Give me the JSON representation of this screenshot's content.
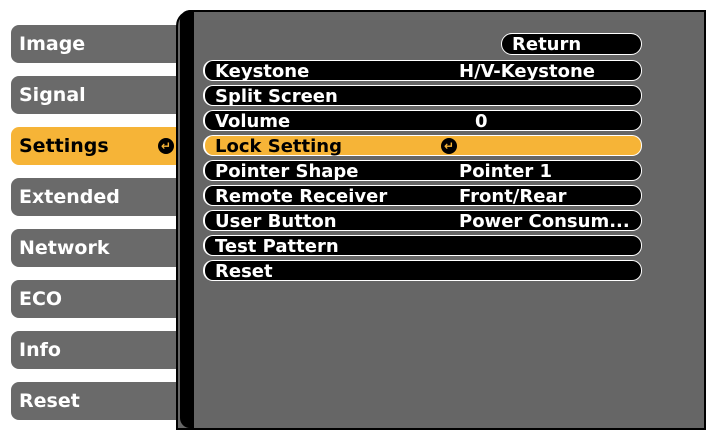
{
  "tabs": [
    {
      "label": "Image"
    },
    {
      "label": "Signal"
    },
    {
      "label": "Settings",
      "active": true
    },
    {
      "label": "Extended"
    },
    {
      "label": "Network"
    },
    {
      "label": "ECO"
    },
    {
      "label": "Info"
    },
    {
      "label": "Reset"
    }
  ],
  "return_label": "Return",
  "menu_items": [
    {
      "label": "Keystone",
      "value": "H/V-Keystone"
    },
    {
      "label": "Split Screen",
      "value": ""
    },
    {
      "label": "Volume",
      "value": "0"
    },
    {
      "label": "Lock Setting",
      "value": "",
      "active": true
    },
    {
      "label": "Pointer Shape",
      "value": "Pointer 1"
    },
    {
      "label": "Remote Receiver",
      "value": "Front/Rear"
    },
    {
      "label": "User Button",
      "value": "Power Consum..."
    },
    {
      "label": "Test Pattern",
      "value": ""
    },
    {
      "label": "Reset",
      "value": ""
    }
  ],
  "icons": {
    "enter": "enter-icon"
  },
  "colors": {
    "accent": "#f6b437",
    "panel": "#666666",
    "row": "#000000"
  }
}
